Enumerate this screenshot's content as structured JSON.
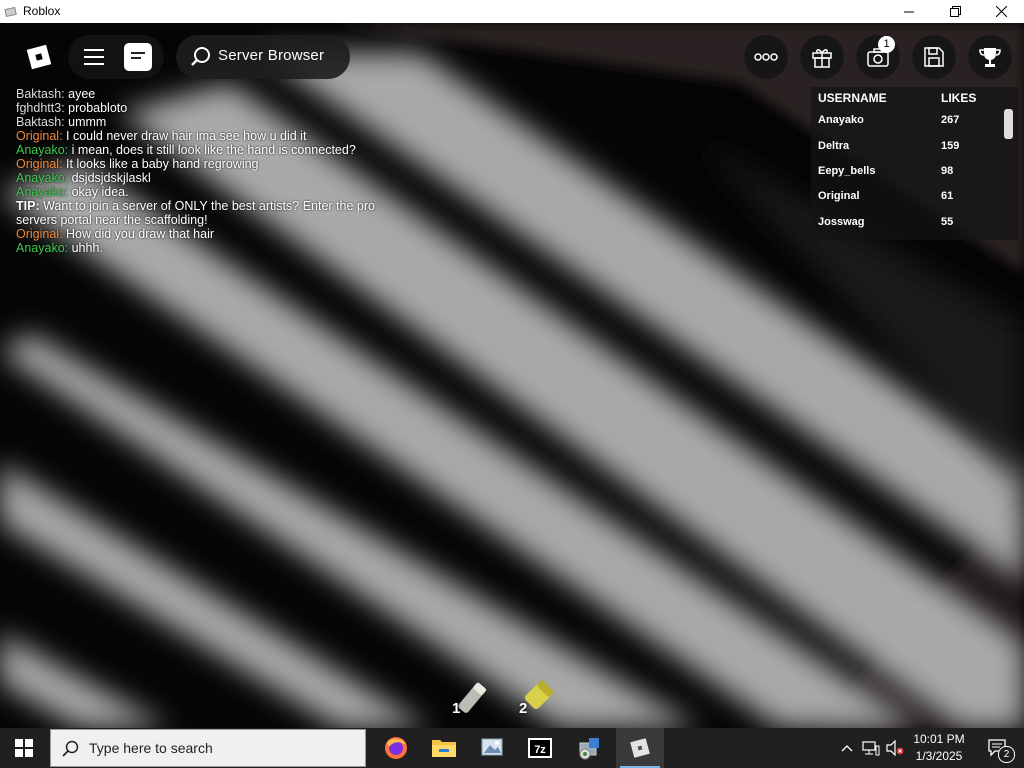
{
  "window": {
    "title": "Roblox"
  },
  "topbar": {
    "server_browser_label": "Server Browser",
    "camera_badge": "1"
  },
  "chat": [
    {
      "name": "Baktash:",
      "name_color": "#dcdcdc",
      "text": " ayee"
    },
    {
      "name": "fghdhtt3:",
      "name_color": "#dcdcdc",
      "text": " probabloto"
    },
    {
      "name": "Baktash:",
      "name_color": "#dcdcdc",
      "text": " ummm"
    },
    {
      "name": "Original:",
      "name_color": "#f08a3c",
      "text": " I could never draw hair ima see how u did it"
    },
    {
      "name": "Anayako:",
      "name_color": "#3ec94e",
      "text": " i mean, does it still look like the hand is connected?"
    },
    {
      "name": "Original:",
      "name_color": "#f08a3c",
      "text": " It looks like a baby hand regrowing"
    },
    {
      "name": "Anayako:",
      "name_color": "#3ec94e",
      "text": " dsjdsjdskjlaskl"
    },
    {
      "name": "Anayako:",
      "name_color": "#3ec94e",
      "text": " okay idea."
    },
    {
      "name": "TIP:",
      "name_color": "#ffffff",
      "text": " Want to join a server of ONLY the best artists? Enter the pro"
    },
    {
      "name": "",
      "name_color": "#ffffff",
      "text": "servers portal near the scaffolding!"
    },
    {
      "name": "Original:",
      "name_color": "#f08a3c",
      "text": " How did you draw that hair"
    },
    {
      "name": "Anayako:",
      "name_color": "#3ec94e",
      "text": " uhhh."
    }
  ],
  "leaderboard": {
    "headers": {
      "username": "USERNAME",
      "likes": "LIKES"
    },
    "rows": [
      {
        "username": "Anayako",
        "likes": "267"
      },
      {
        "username": "Deltra",
        "likes": "159"
      },
      {
        "username": "Eepy_bells",
        "likes": "98"
      },
      {
        "username": "Original",
        "likes": "61"
      },
      {
        "username": "Josswag",
        "likes": "55"
      }
    ]
  },
  "hotbar": [
    {
      "slot": "1",
      "icon": "eraser-tool-icon"
    },
    {
      "slot": "2",
      "icon": "paint-tool-icon"
    }
  ],
  "taskbar": {
    "search_placeholder": "Type here to search",
    "apps": [
      "firefox-icon",
      "file-explorer-icon",
      "photos-icon",
      "7zip-icon",
      "control-panel-icon",
      "roblox-icon"
    ],
    "clock_time": "10:01 PM",
    "clock_date": "1/3/2025",
    "notification_count": "2"
  },
  "colors": {
    "accent": "#7fb7ea",
    "taskbar": "#202020",
    "orange_name": "#f08a3c",
    "green_name": "#3ec94e"
  }
}
